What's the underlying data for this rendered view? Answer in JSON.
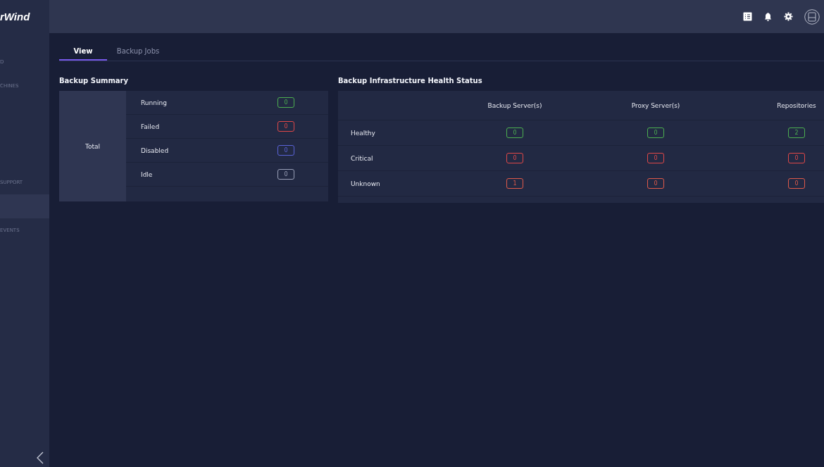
{
  "sidebar": {
    "logo": "rWind",
    "items": [
      {
        "label": "D",
        "selected": false
      },
      {
        "label": "CHINES",
        "selected": false
      },
      {
        "label": "SUPPORT",
        "selected": false
      },
      {
        "selected": true
      },
      {
        "label": "EVENTS",
        "selected": false
      }
    ]
  },
  "tabs": [
    {
      "label": "View",
      "selected": true
    },
    {
      "label": "Backup Jobs",
      "selected": false
    }
  ],
  "backup_summary": {
    "title": "Backup Summary",
    "total_label": "Total",
    "rows": [
      {
        "label": "Running",
        "value": "0",
        "color": "#4caf50"
      },
      {
        "label": "Failed",
        "value": "0",
        "color": "#e04848"
      },
      {
        "label": "Disabled",
        "value": "0",
        "color": "#5a63d8"
      },
      {
        "label": "Idle",
        "value": "0",
        "color": "#9aa0b8"
      }
    ]
  },
  "health": {
    "title": "Backup Infrastructure Health Status",
    "columns": [
      "Backup Server(s)",
      "Proxy Server(s)",
      "Repositories"
    ],
    "rows": [
      {
        "label": "Healthy",
        "values": [
          "0",
          "0",
          "2"
        ],
        "color": "#4caf50"
      },
      {
        "label": "Critical",
        "values": [
          "0",
          "0",
          "0"
        ],
        "color": "#e04848"
      },
      {
        "label": "Unknown",
        "values": [
          "1",
          "0",
          "0"
        ],
        "color": "#e05a4a"
      }
    ]
  }
}
